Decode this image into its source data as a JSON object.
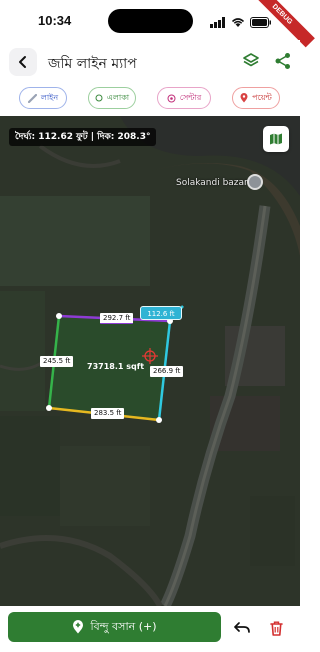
{
  "status_bar": {
    "time": "10:34",
    "debug_label": "DEBUG"
  },
  "app_bar": {
    "title": "জমি লাইন ম্যাপ"
  },
  "modes": [
    {
      "label": "লাইন",
      "icon": "ruler-icon",
      "color": "#3a5bc7"
    },
    {
      "label": "এলাকা",
      "icon": "area-circle-icon",
      "color": "#3a8a3e"
    },
    {
      "label": "সেন্টার",
      "icon": "target-icon",
      "color": "#c2307b"
    },
    {
      "label": "পয়েন্ট",
      "icon": "pin-icon",
      "color": "#c73030"
    }
  ],
  "map": {
    "measurement": "দৈর্ঘ্য: 112.62 ফুট | দিক: 208.3°",
    "place_name": "Solakandi bazar",
    "edges": [
      {
        "label": "292.7 ft",
        "color": "#8e3bd4"
      },
      {
        "label": "245.5 ft",
        "color": "#35b34a"
      },
      {
        "label": "283.5 ft",
        "color": "#e6b820"
      },
      {
        "label": "266.9 ft",
        "color": "#2fc9e0"
      }
    ],
    "area": "73718.1 sqft",
    "live_segment": "112.6 ft"
  },
  "bottom_bar": {
    "add_point_label": "বিন্দু বসান (+)"
  },
  "colors": {
    "primary": "#2f7d32",
    "delete": "#d32f2f",
    "live_line": "#2fc9e0"
  }
}
